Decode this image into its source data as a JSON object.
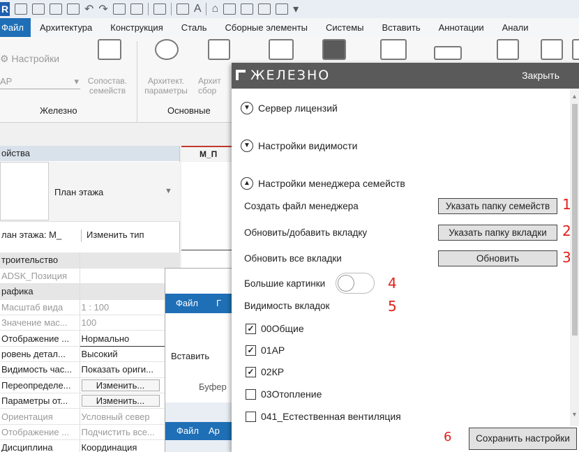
{
  "revit": {
    "app_logo": "R",
    "ribbon_tabs": [
      "Файл",
      "Архитектура",
      "Конструкция",
      "Сталь",
      "Сборные элементы",
      "Системы",
      "Вставить",
      "Аннотации",
      "Анали"
    ],
    "panel": {
      "settings_button": "Настройки",
      "dropdown_value": "АР",
      "match_families": [
        "Сопостав.",
        "семейств"
      ],
      "arch_params": [
        "Архитект.",
        "параметры"
      ],
      "arch2": [
        "Архит",
        "сбор"
      ],
      "group_zhelezno": "Железно",
      "group_main": "Основные"
    },
    "properties": {
      "header": "ойства",
      "type_name": "План этажа",
      "filter_value": "лан этажа: М_",
      "edit_type": "Изменить тип",
      "rows": [
        {
          "k": "троительство",
          "v": "",
          "group": true
        },
        {
          "k": "ADSK_Позиция",
          "v": "",
          "muted": true
        },
        {
          "k": "рафика",
          "v": "",
          "group": true
        },
        {
          "k": "Масштаб вида",
          "v": "1 : 100",
          "muted": true
        },
        {
          "k": "Значение мас...",
          "v": "100",
          "muted": true
        },
        {
          "k": "Отображение ...",
          "v": "Нормально",
          "boxed": true
        },
        {
          "k": "ровень детал...",
          "v": "Высокий"
        },
        {
          "k": "Видимость час...",
          "v": "Показать ориги..."
        },
        {
          "k": "Переопределе...",
          "v": "Изменить...",
          "button": true
        },
        {
          "k": "Параметры от...",
          "v": "Изменить...",
          "button": true
        },
        {
          "k": "Ориентация",
          "v": "Условный север",
          "muted": true
        },
        {
          "k": "Отображение ...",
          "v": "Подчистить все...",
          "muted": true
        },
        {
          "k": "Дисциплина",
          "v": "Координация"
        }
      ]
    },
    "view_tab": "М_П",
    "child": {
      "tab_file": "Файл",
      "tab2": "Г",
      "paste": "Вставить",
      "buffer": "Буфер",
      "tab_file2": "Файл",
      "tab_ar": "Ар"
    }
  },
  "dialog": {
    "title": "ЖЕЛЕЗНО",
    "close": "Закрыть",
    "sections": {
      "license": "Сервер лицензий",
      "visibility": "Настройки видимости",
      "family_manager": "Настройки менеджера семейств"
    },
    "rows": {
      "create_manager": "Создать файл менеджера",
      "update_tab": "Обновить/добавить вкладку",
      "update_all": "Обновить все вкладки",
      "big_pictures": "Большие картинки",
      "tabs_visibility": "Видимость вкладок"
    },
    "buttons": {
      "families_folder": "Указать папку семейств",
      "tab_folder": "Указать папку вкладки",
      "update": "Обновить",
      "save": "Сохранить настройки"
    },
    "annotations": [
      "1",
      "2",
      "3",
      "4",
      "5",
      "6"
    ],
    "big_pictures_on": false,
    "tabs": [
      {
        "name": "00Общие",
        "checked": true
      },
      {
        "name": "01АР",
        "checked": true
      },
      {
        "name": "02КР",
        "checked": true
      },
      {
        "name": "03Отопление",
        "checked": false
      },
      {
        "name": "041_Естественная вентиляция",
        "checked": false
      }
    ],
    "colors": {
      "header": "#5a5a5a",
      "annotation": "#e0201b",
      "button": "#e1e1e1"
    }
  }
}
